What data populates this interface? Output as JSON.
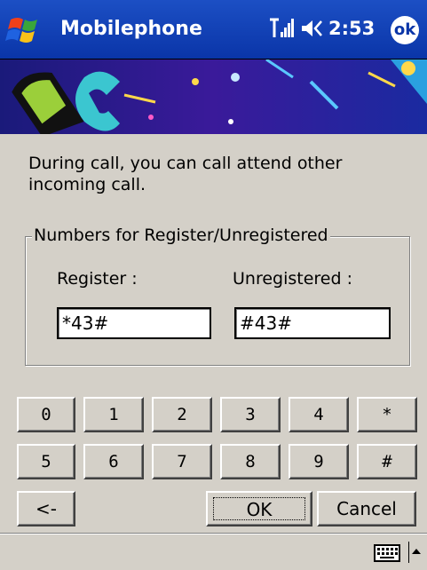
{
  "titlebar": {
    "title": "Mobilephone",
    "clock": "2:53",
    "ok_label": "ok"
  },
  "description": "During call, you can call attend other incoming call.",
  "group": {
    "legend": "Numbers for Register/Unregistered",
    "register_label": "Register :",
    "unregister_label": "Unregistered :",
    "register_value": "*43#",
    "unregister_value": "#43#"
  },
  "keypad": {
    "row1": [
      "0",
      "1",
      "2",
      "3",
      "4",
      "*"
    ],
    "row2": [
      "5",
      "6",
      "7",
      "8",
      "9",
      "#"
    ],
    "back": "<-",
    "ok": "OK",
    "cancel": "Cancel"
  },
  "icons": {
    "start": "windows-flag-icon",
    "signal": "signal-icon",
    "volume": "volume-icon",
    "keyboard": "keyboard-icon"
  }
}
